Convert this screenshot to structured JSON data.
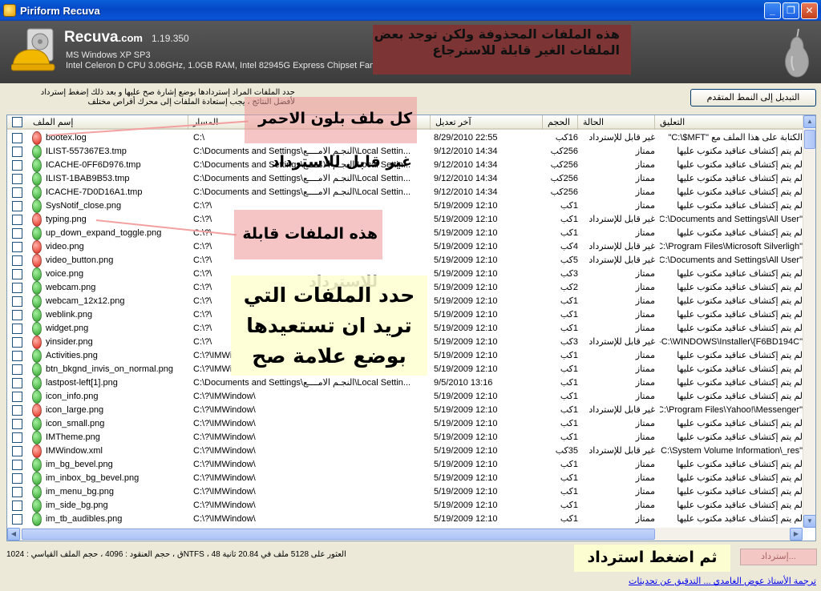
{
  "window": {
    "title": "Piriform Recuva",
    "min_glyph": "_",
    "max_glyph": "❐",
    "close_glyph": "✕"
  },
  "header": {
    "brand_name": "Recuva",
    "brand_suffix": ".com",
    "version": "1.19.350",
    "os": "MS Windows XP SP3",
    "hardware": "Intel Celeron D CPU 3.06GHz, 1.0GB RAM, Intel 82945G Express Chipset Family"
  },
  "notes": {
    "header_note": "هذه الملفات المحذوفة ولكن توجد بعض الملفات الغير قابلة للاسترجاع",
    "red_note": "كل ملف بلون الاحمر غير قابل للاسترداد",
    "green_note": "هذه الملفات قابلة للاسترداد",
    "select_note": "حدد الملفات التي تريد ان تستعيدها بوضع علامة صح",
    "recover_note": "ثم اضغط استرداد"
  },
  "info": {
    "line1": "حدد الملفات المراد إستردادها بوضع إشارة صح عليها و بعد ذلك إضغط إسترداد",
    "line2": "لأفضل النتائج ، يجب إستعادة الملفات إلى محرك أقراص مختلف"
  },
  "toolbar": {
    "advanced_label": "التبديل إلى النمط المتقدم"
  },
  "columns": {
    "name": "إسم الملف",
    "path": "المسار",
    "date": "آخر تعديل",
    "size": "الحجم",
    "state": "الحالة",
    "comment": "التعليق"
  },
  "rows": [
    {
      "status": "red",
      "name": "bootex.log",
      "path": "C:\\",
      "date": "8/29/2010 22:55",
      "size": "16كب",
      "state": "غير قابل للإسترداد",
      "comment": "الكتابة على هذا الملف مع \"C:\\$MFT\""
    },
    {
      "status": "green",
      "name": "ILIST-557367E3.tmp",
      "path": "C:\\Documents and Settings\\النجـم الامــــع\\Local Settin...",
      "date": "9/12/2010 14:34",
      "size": "256كب",
      "state": "ممتاز",
      "comment": "لم يتم إكتشاف عناقيد مكتوب عليها"
    },
    {
      "status": "green",
      "name": "ICACHE-0FF6D976.tmp",
      "path": "C:\\Documents and Settings\\النجـم الامــــع\\Local Settin...",
      "date": "9/12/2010 14:34",
      "size": "256كب",
      "state": "ممتاز",
      "comment": "لم يتم إكتشاف عناقيد مكتوب عليها"
    },
    {
      "status": "green",
      "name": "ILIST-1BAB9B53.tmp",
      "path": "C:\\Documents and Settings\\النجـم الامــــع\\Local Settin...",
      "date": "9/12/2010 14:34",
      "size": "256كب",
      "state": "ممتاز",
      "comment": "لم يتم إكتشاف عناقيد مكتوب عليها"
    },
    {
      "status": "green",
      "name": "ICACHE-7D0D16A1.tmp",
      "path": "C:\\Documents and Settings\\النجـم الامــــع\\Local Settin...",
      "date": "9/12/2010 14:34",
      "size": "256كب",
      "state": "ممتاز",
      "comment": "لم يتم إكتشاف عناقيد مكتوب عليها"
    },
    {
      "status": "green",
      "name": "SysNotif_close.png",
      "path": "C:\\?\\",
      "date": "5/19/2009 12:10",
      "size": "1كب",
      "state": "ممتاز",
      "comment": "لم يتم إكتشاف عناقيد مكتوب عليها"
    },
    {
      "status": "red",
      "name": "typing.png",
      "path": "C:\\?\\",
      "date": "5/19/2009 12:10",
      "size": "1كب",
      "state": "غير قابل للإسترداد",
      "comment": "\"C:\\Documents and Settings\\All User"
    },
    {
      "status": "green",
      "name": "up_down_expand_toggle.png",
      "path": "C:\\?\\",
      "date": "5/19/2009 12:10",
      "size": "1كب",
      "state": "ممتاز",
      "comment": "لم يتم إكتشاف عناقيد مكتوب عليها"
    },
    {
      "status": "red",
      "name": "video.png",
      "path": "C:\\?\\",
      "date": "5/19/2009 12:10",
      "size": "4كب",
      "state": "غير قابل للإسترداد",
      "comment": "\"C:\\Program Files\\Microsoft Silverligh"
    },
    {
      "status": "red",
      "name": "video_button.png",
      "path": "C:\\?\\",
      "date": "5/19/2009 12:10",
      "size": "5كب",
      "state": "غير قابل للإسترداد",
      "comment": "\"C:\\Documents and Settings\\All User"
    },
    {
      "status": "green",
      "name": "voice.png",
      "path": "C:\\?\\",
      "date": "5/19/2009 12:10",
      "size": "3كب",
      "state": "ممتاز",
      "comment": "لم يتم إكتشاف عناقيد مكتوب عليها"
    },
    {
      "status": "green",
      "name": "webcam.png",
      "path": "C:\\?\\",
      "date": "5/19/2009 12:10",
      "size": "2كب",
      "state": "ممتاز",
      "comment": "لم يتم إكتشاف عناقيد مكتوب عليها"
    },
    {
      "status": "green",
      "name": "webcam_12x12.png",
      "path": "C:\\?\\",
      "date": "5/19/2009 12:10",
      "size": "1كب",
      "state": "ممتاز",
      "comment": "لم يتم إكتشاف عناقيد مكتوب عليها"
    },
    {
      "status": "green",
      "name": "weblink.png",
      "path": "C:\\?\\",
      "date": "5/19/2009 12:10",
      "size": "1كب",
      "state": "ممتاز",
      "comment": "لم يتم إكتشاف عناقيد مكتوب عليها"
    },
    {
      "status": "green",
      "name": "widget.png",
      "path": "C:\\?\\",
      "date": "5/19/2009 12:10",
      "size": "1كب",
      "state": "ممتاز",
      "comment": "لم يتم إكتشاف عناقيد مكتوب عليها"
    },
    {
      "status": "red",
      "name": "yinsider.png",
      "path": "C:\\?\\",
      "date": "5/19/2009 12:10",
      "size": "3كب",
      "state": "غير قابل للإسترداد",
      "comment": "\"C:\\WINDOWS\\Installer\\{F6BD194C-"
    },
    {
      "status": "green",
      "name": "Activities.png",
      "path": "C:\\?\\IMWi",
      "date": "5/19/2009 12:10",
      "size": "1كب",
      "state": "ممتاز",
      "comment": "لم يتم إكتشاف عناقيد مكتوب عليها"
    },
    {
      "status": "green",
      "name": "btn_bkgnd_invis_on_normal.png",
      "path": "C:\\?\\IMWi",
      "date": "5/19/2009 12:10",
      "size": "1كب",
      "state": "ممتاز",
      "comment": "لم يتم إكتشاف عناقيد مكتوب عليها"
    },
    {
      "status": "green",
      "name": "lastpost-left[1].png",
      "path": "C:\\Documents and Settings\\النجـم الامــــع\\Local Settin...",
      "date": "9/5/2010 13:16",
      "size": "1كب",
      "state": "ممتاز",
      "comment": "لم يتم إكتشاف عناقيد مكتوب عليها"
    },
    {
      "status": "green",
      "name": "icon_info.png",
      "path": "C:\\?\\IMWindow\\",
      "date": "5/19/2009 12:10",
      "size": "1كب",
      "state": "ممتاز",
      "comment": "لم يتم إكتشاف عناقيد مكتوب عليها"
    },
    {
      "status": "red",
      "name": "icon_large.png",
      "path": "C:\\?\\IMWindow\\",
      "date": "5/19/2009 12:10",
      "size": "1كب",
      "state": "غير قابل للإسترداد",
      "comment": "\"C:\\Program Files\\Yahoo!\\Messenger"
    },
    {
      "status": "green",
      "name": "icon_small.png",
      "path": "C:\\?\\IMWindow\\",
      "date": "5/19/2009 12:10",
      "size": "1كب",
      "state": "ممتاز",
      "comment": "لم يتم إكتشاف عناقيد مكتوب عليها"
    },
    {
      "status": "green",
      "name": "IMTheme.png",
      "path": "C:\\?\\IMWindow\\",
      "date": "5/19/2009 12:10",
      "size": "1كب",
      "state": "ممتاز",
      "comment": "لم يتم إكتشاف عناقيد مكتوب عليها"
    },
    {
      "status": "red",
      "name": "IMWindow.xml",
      "path": "C:\\?\\IMWindow\\",
      "date": "5/19/2009 12:10",
      "size": "35كب",
      "state": "غير قابل للإسترداد",
      "comment": "\"C:\\System Volume Information\\_res"
    },
    {
      "status": "green",
      "name": "im_bg_bevel.png",
      "path": "C:\\?\\IMWindow\\",
      "date": "5/19/2009 12:10",
      "size": "1كب",
      "state": "ممتاز",
      "comment": "لم يتم إكتشاف عناقيد مكتوب عليها"
    },
    {
      "status": "green",
      "name": "im_inbox_bg_bevel.png",
      "path": "C:\\?\\IMWindow\\",
      "date": "5/19/2009 12:10",
      "size": "1كب",
      "state": "ممتاز",
      "comment": "لم يتم إكتشاف عناقيد مكتوب عليها"
    },
    {
      "status": "green",
      "name": "im_menu_bg.png",
      "path": "C:\\?\\IMWindow\\",
      "date": "5/19/2009 12:10",
      "size": "1كب",
      "state": "ممتاز",
      "comment": "لم يتم إكتشاف عناقيد مكتوب عليها"
    },
    {
      "status": "green",
      "name": "im_side_bg.png",
      "path": "C:\\?\\IMWindow\\",
      "date": "5/19/2009 12:10",
      "size": "1كب",
      "state": "ممتاز",
      "comment": "لم يتم إكتشاف عناقيد مكتوب عليها"
    },
    {
      "status": "green",
      "name": "im_tb_audibles.png",
      "path": "C:\\?\\IMWindow\\",
      "date": "5/19/2009 12:10",
      "size": "1كب",
      "state": "ممتاز",
      "comment": "لم يتم إكتشاف عناقيد مكتوب عليها"
    }
  ],
  "status_bar": {
    "text": "العثور على 5128 ملف في 20.84 ثانية NTFS ، 48ق ، حجم العنقود : 4096 ، حجم الملف القياسي : 1024",
    "recover_label": "إسترداد..."
  },
  "footer": {
    "link_text": "ترجمة الأستاذ عوض الغامدي ... التدقيق عن تحديثات"
  },
  "colors": {
    "green": "#2fa32a",
    "red": "#e02a1a",
    "header_bg": "#4a4a4a"
  }
}
